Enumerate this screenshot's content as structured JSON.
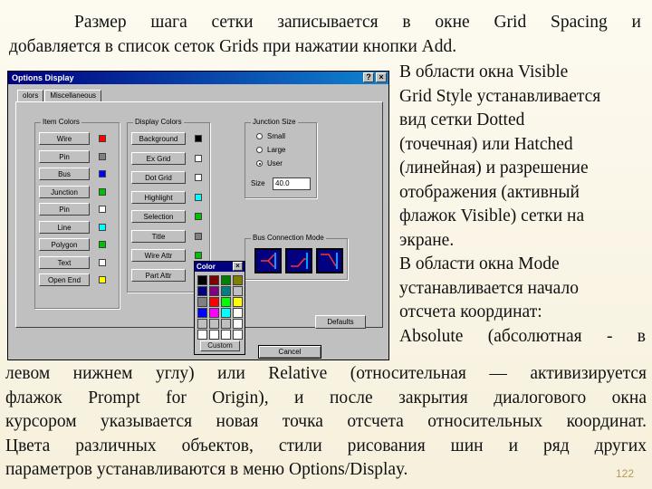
{
  "paragraphs": {
    "top_line1": "Размер шага сетки записывается в окне Grid Spacing и",
    "top_line2": "добавляется в список сеток Grids при нажатии кнопки Add.",
    "right_lines": [
      "В области окна Visible",
      "Grid Style устанавливается",
      "вид сетки Dotted",
      "(точечная) или Hatched",
      "(линейная) и разрешение",
      "отображения (активный",
      "флажок Visible) сетки на",
      "экране.",
      "В области окна Mode",
      " устанавливается начало",
      "отсчета координат:",
      "Absolute (абсолютная - в"
    ],
    "bottom_lines": [
      "левом нижнем углу) или Relative (относительная — активизируется",
      "флажок Prompt for Origin), и после закрытия диалогового окна",
      "курсором указывается новая точка отсчета относительных координат.",
      "Цвета различных объектов, стили рисования шин и ряд других",
      "параметров устанавливаются в меню Options/Display."
    ]
  },
  "page_number": "122",
  "dialog": {
    "title": "Options Display",
    "tabs": [
      "olors",
      "Miscellaneous"
    ],
    "item_colors": {
      "label": "Item Colors",
      "buttons": [
        "Wire",
        "Pin",
        "Bus",
        "Junction",
        "Pin",
        "Line",
        "Polygon",
        "Text",
        "Open End"
      ],
      "colors": [
        "#ff0000",
        "#808080",
        "#0000ff",
        "#00c000",
        "#ffffff",
        "#00ffff",
        "#00c000",
        "#ffffff",
        "#ffff00"
      ]
    },
    "display_colors": {
      "label": "Display Colors",
      "buttons": [
        "Background",
        "Ex Grid",
        "Dot Grid",
        "Highlight",
        "Selection",
        "Title",
        "Wire Attr",
        "Part Attr"
      ],
      "colors": [
        "#000000",
        "#ffffff",
        "#ffffff",
        "#00ffff",
        "#00c000",
        "#808080",
        "#00c000",
        "#00c000"
      ]
    },
    "junction_size": {
      "label": "Junction Size",
      "options": [
        "Small",
        "Large",
        "User"
      ],
      "selected": 2,
      "size_label": "Size",
      "size_value": "40.0"
    },
    "bus_mode": {
      "label": "Bus Connection Mode"
    },
    "defaults_label": "Defaults",
    "bottom_button": "Cancel"
  },
  "color_popup": {
    "title": "Color",
    "close": "×",
    "cells": [
      "#000000",
      "#800000",
      "#008000",
      "#808000",
      "#000080",
      "#800080",
      "#008080",
      "#c0c0c0",
      "#808080",
      "#ff0000",
      "#00ff00",
      "#ffff00",
      "#0000ff",
      "#ff00ff",
      "#00ffff",
      "#ffffff",
      "#c0c0c0",
      "#c0c0c0",
      "#c0c0c0",
      "#ffffff",
      "#ffffff",
      "#ffffff",
      "#ffffff",
      "#ffffff"
    ],
    "button": "Custom"
  }
}
